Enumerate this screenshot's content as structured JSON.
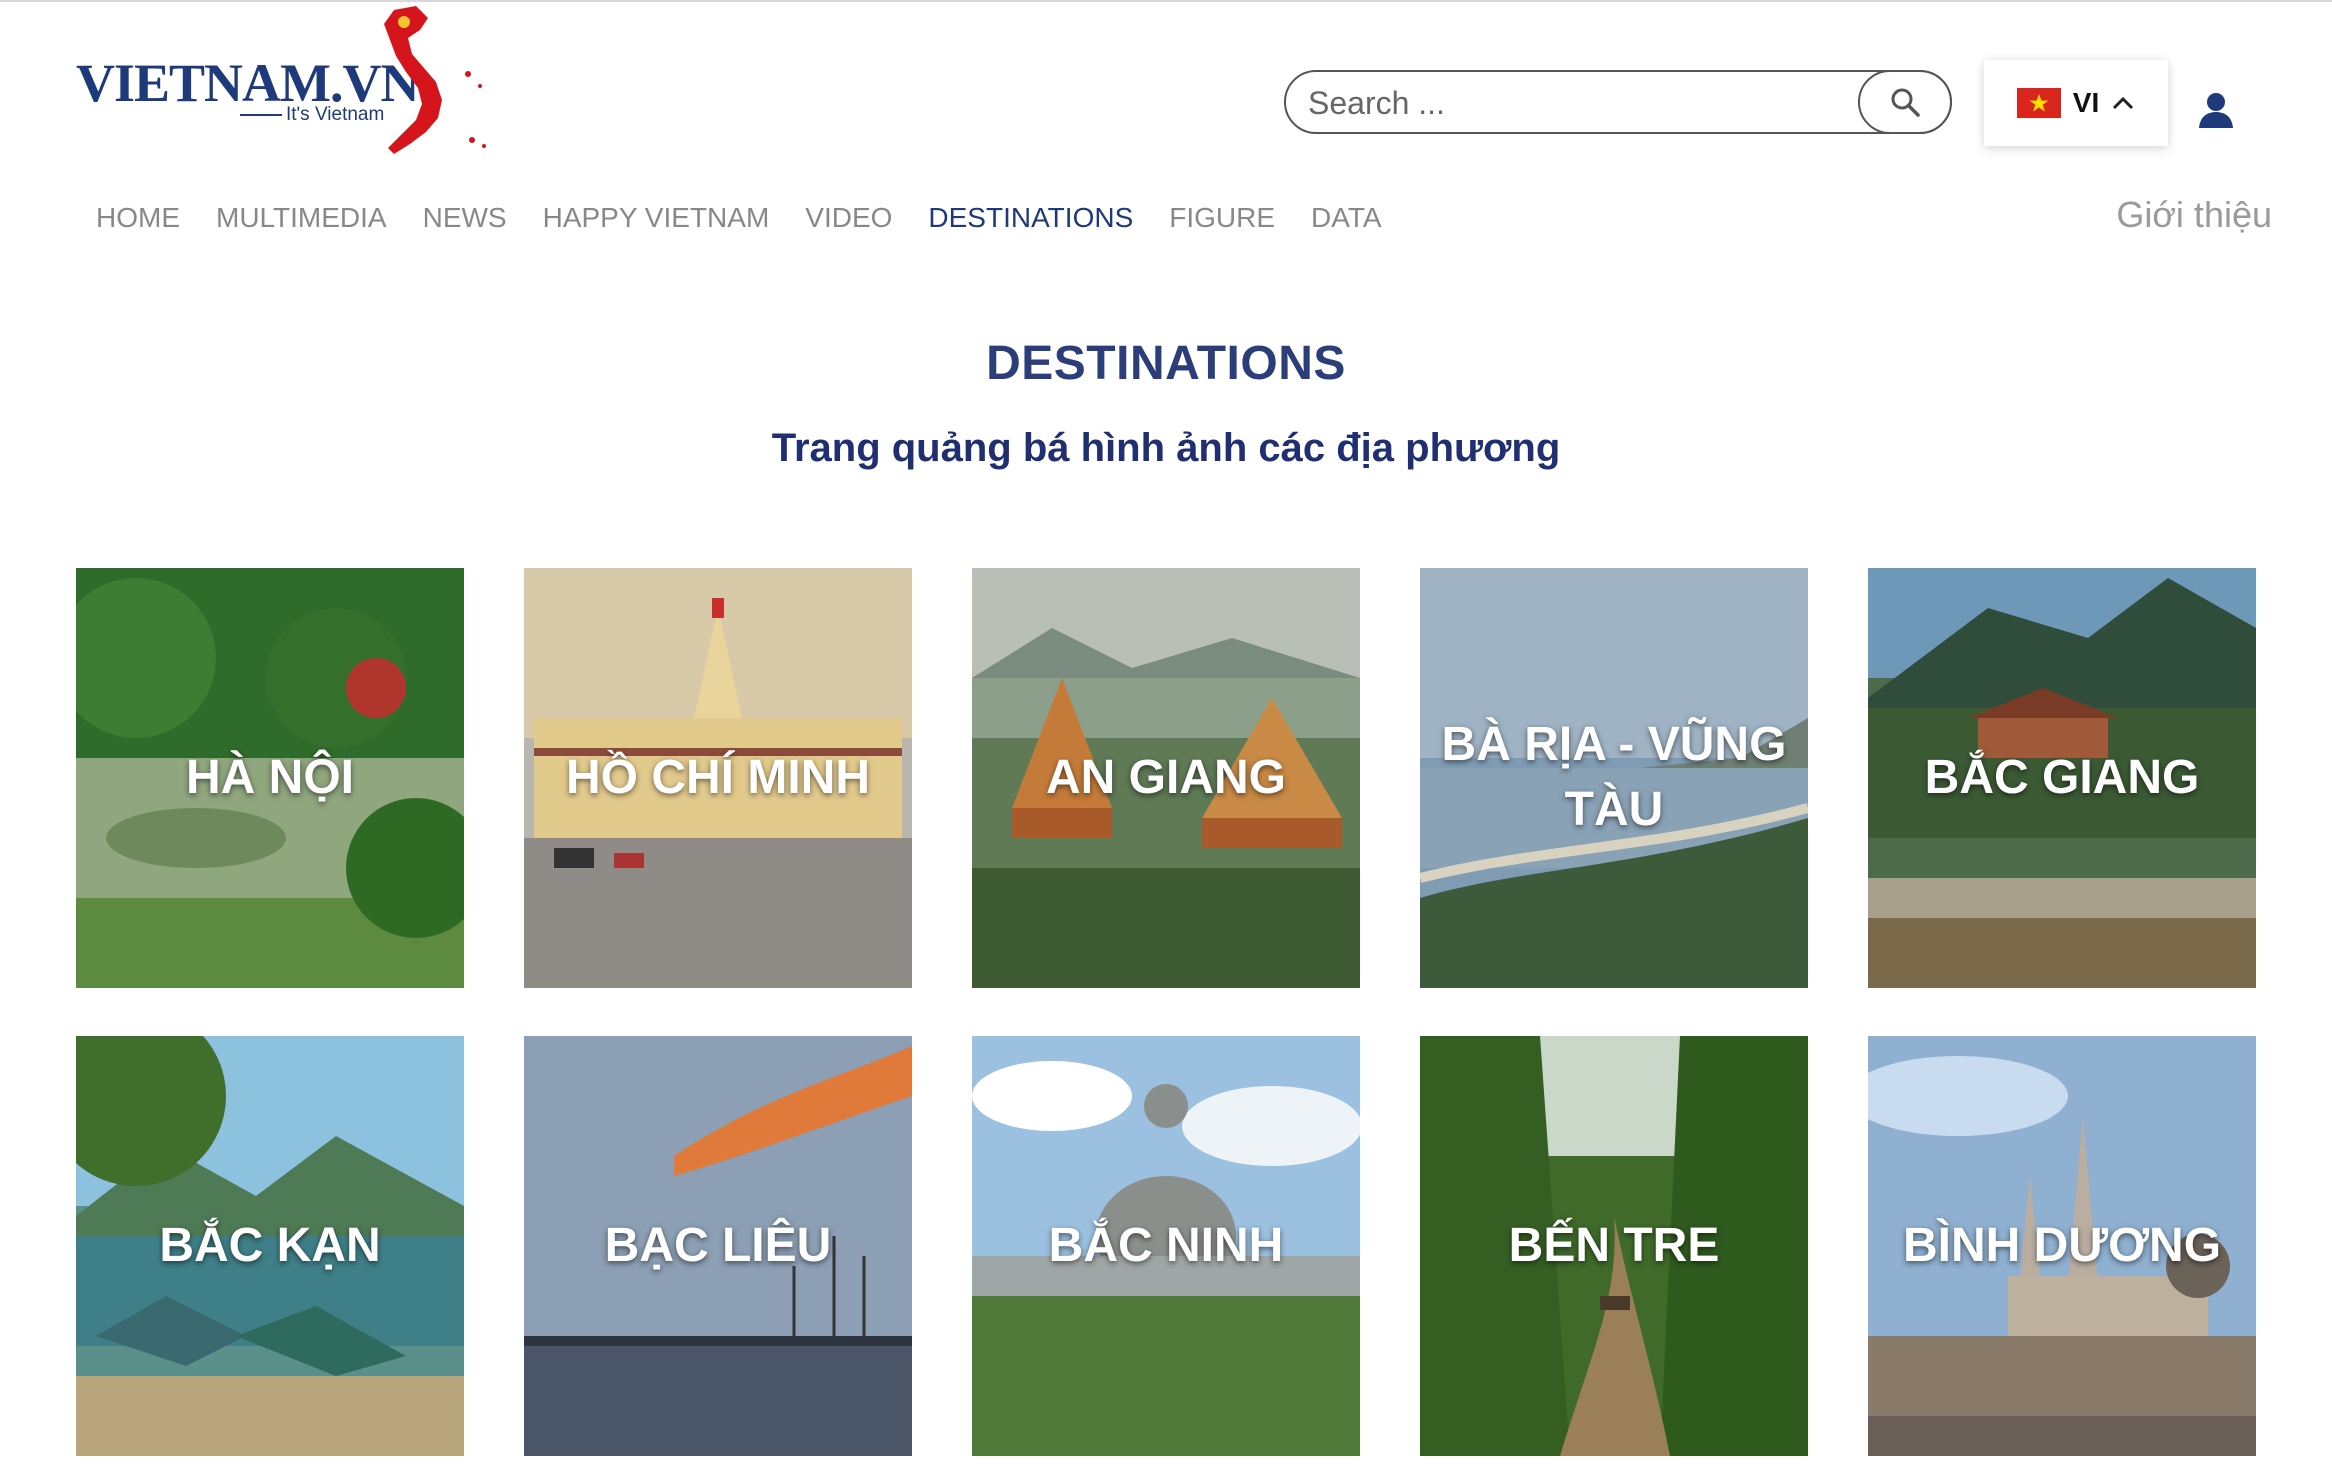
{
  "logo": {
    "text": "VIETNAM.VN",
    "tagline": "It's Vietnam"
  },
  "search": {
    "placeholder": "Search ..."
  },
  "language": {
    "code": "VI"
  },
  "nav": {
    "items": [
      "HOME",
      "MULTIMEDIA",
      "NEWS",
      "HAPPY VIETNAM",
      "VIDEO",
      "DESTINATIONS",
      "FIGURE",
      "DATA"
    ],
    "active": "DESTINATIONS",
    "intro": "Giới thiệu"
  },
  "page": {
    "title": "DESTINATIONS",
    "subtitle": "Trang quảng bá hình ảnh các địa phương"
  },
  "destinations": [
    {
      "name": "HÀ NỘI"
    },
    {
      "name": "HỒ CHÍ MINH"
    },
    {
      "name": "AN GIANG"
    },
    {
      "name": "BÀ RỊA - VŨNG TÀU"
    },
    {
      "name": "BẮC GIANG"
    },
    {
      "name": "BẮC KẠN"
    },
    {
      "name": "BẠC LIÊU"
    },
    {
      "name": "BẮC NINH"
    },
    {
      "name": "BẾN TRE"
    },
    {
      "name": "BÌNH DƯƠNG"
    }
  ],
  "colors": {
    "brand": "#1f3a7a",
    "flag_red": "#da251d",
    "nav_inactive": "#888888"
  }
}
